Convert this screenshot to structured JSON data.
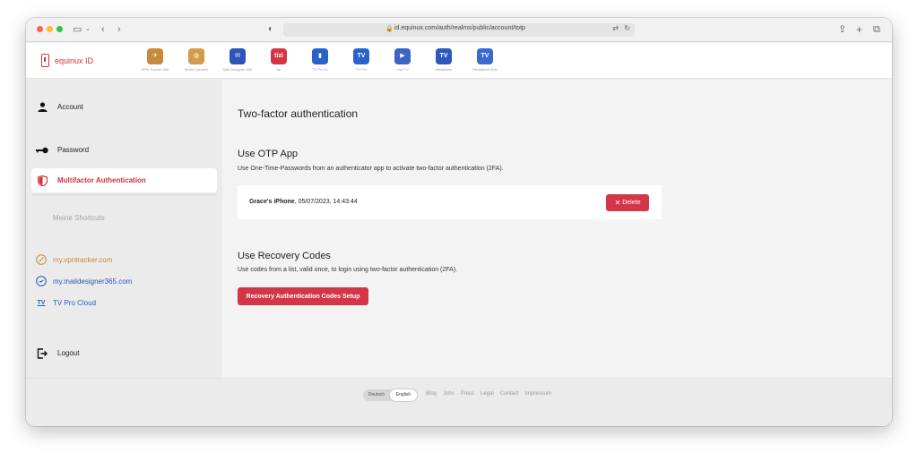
{
  "browser": {
    "url": "id.equinux.com/auth/realms/public/account/totp"
  },
  "brand": {
    "name": "equinux ID"
  },
  "apps": [
    {
      "label": "VPN Tracker 365",
      "bg": "#c58a3a",
      "glyph": "✈"
    },
    {
      "label": "World Connect",
      "bg": "#d59a4c",
      "glyph": "◍"
    },
    {
      "label": "Mail Designer 365",
      "bg": "#2d55b8",
      "glyph": "✉"
    },
    {
      "label": "tizi",
      "bg": "#d33747",
      "glyph": "tizi"
    },
    {
      "label": "TV Pro iO",
      "bg": "#2a62c9",
      "glyph": "▮"
    },
    {
      "label": "TV Pro",
      "bg": "#2a62c9",
      "glyph": "TV"
    },
    {
      "label": "Live TV",
      "bg": "#3d64c2",
      "glyph": "▶"
    },
    {
      "label": "Mediathek",
      "bg": "#2e58bd",
      "glyph": "TV"
    },
    {
      "label": "Mediathek Kids",
      "bg": "#3a6ad0",
      "glyph": "TV"
    }
  ],
  "sidebar": {
    "items": [
      {
        "label": "Account"
      },
      {
        "label": "Password"
      },
      {
        "label": "Multifactor Authentication"
      }
    ],
    "shortcuts_title": "Meine Shortcuts",
    "shortcuts": [
      {
        "label": "my.vpntracker.com",
        "color": "#c7893a"
      },
      {
        "label": "my.maildesigner365.com",
        "color": "#2d55b8"
      },
      {
        "label": "TV Pro Cloud",
        "color": "#2a62c9"
      }
    ],
    "logout": "Logout"
  },
  "main": {
    "title": "Two-factor authentication",
    "otp": {
      "heading": "Use OTP App",
      "description": "Use One-Time-Passwords from an authenticator app to activate two-factor authentication (2FA).",
      "device_name": "Grace's iPhone",
      "device_date": ", 05/07/2023, 14:43:44",
      "delete_label": "Delete"
    },
    "recovery": {
      "heading": "Use Recovery Codes",
      "description": "Use codes from a list, valid once, to login using two-factor authentication (2FA).",
      "button_label": "Recovery Authentication Codes Setup"
    }
  },
  "footer": {
    "languages": [
      "Deutsch",
      "English"
    ],
    "selected_language": "English",
    "links": [
      "Blog",
      "Jobs",
      "Press",
      "Legal",
      "Contact",
      "Impressum"
    ]
  },
  "colors": {
    "accent": "#d0343a",
    "button": "#d33747"
  }
}
